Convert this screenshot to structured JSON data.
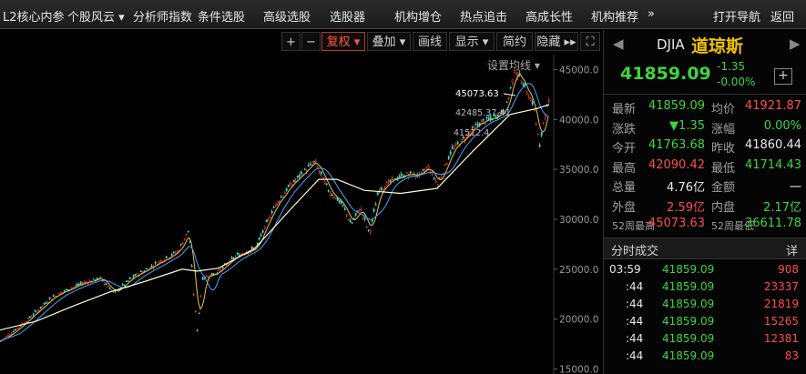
{
  "nav": {
    "items": [
      "L2核心内参",
      "个股风云 ▾",
      "分析师指数",
      "条件选股",
      "高级选股",
      "选股器",
      "机构增仓",
      "热点追击",
      "高成长性",
      "机构推荐",
      "»",
      "打开导航",
      "返回"
    ]
  },
  "toolbar": {
    "plus": "+",
    "minus": "−",
    "fuquan": "复权 ▾",
    "diejia": "叠加 ▾",
    "huaxian": "画线",
    "xianshi": "显示 ▾",
    "jianyue": "简约",
    "yincang": "隐藏 ▸▸",
    "fullscreen": "⛶",
    "set_ma": "设置均线 ▾"
  },
  "chart_data": {
    "type": "candlestick",
    "title": "",
    "price_axis": [
      45000.0,
      40000.0,
      35000.0,
      30000.0,
      25000.0,
      20000.0,
      15000.0
    ],
    "price_axis_labels": [
      "45000.0",
      "40000.0",
      "35000.0",
      "30000.0",
      "25000.0",
      "20000.0",
      "15000.0"
    ],
    "ylim": [
      14500,
      46500
    ],
    "annotations": [
      "45073.63",
      "42485.37-41",
      "41512.4"
    ],
    "close_path": [
      [
        0,
        17800
      ],
      [
        20,
        19200
      ],
      [
        40,
        20800
      ],
      [
        55,
        22100
      ],
      [
        70,
        22800
      ],
      [
        90,
        23600
      ],
      [
        110,
        24100
      ],
      [
        125,
        22600
      ],
      [
        145,
        24200
      ],
      [
        170,
        25500
      ],
      [
        195,
        26800
      ],
      [
        207,
        29000
      ],
      [
        212,
        22500
      ],
      [
        216,
        18900
      ],
      [
        222,
        24100
      ],
      [
        240,
        24800
      ],
      [
        260,
        26400
      ],
      [
        280,
        27100
      ],
      [
        300,
        31200
      ],
      [
        315,
        33100
      ],
      [
        330,
        34500
      ],
      [
        345,
        35800
      ],
      [
        360,
        32900
      ],
      [
        375,
        31500
      ],
      [
        385,
        29500
      ],
      [
        395,
        31200
      ],
      [
        405,
        28500
      ],
      [
        415,
        32900
      ],
      [
        430,
        33900
      ],
      [
        445,
        34500
      ],
      [
        460,
        34400
      ],
      [
        470,
        35200
      ],
      [
        480,
        33500
      ],
      [
        495,
        36900
      ],
      [
        510,
        38200
      ],
      [
        525,
        39600
      ],
      [
        540,
        40100
      ],
      [
        555,
        41100
      ],
      [
        565,
        45073
      ],
      [
        575,
        43400
      ],
      [
        585,
        41500
      ],
      [
        592,
        37200
      ],
      [
        597,
        40400
      ],
      [
        603,
        41859
      ]
    ],
    "ma_slow_path": [
      [
        0,
        18900
      ],
      [
        40,
        19800
      ],
      [
        80,
        21300
      ],
      [
        120,
        22700
      ],
      [
        160,
        23800
      ],
      [
        200,
        25000
      ],
      [
        216,
        24800
      ],
      [
        240,
        25100
      ],
      [
        280,
        27100
      ],
      [
        320,
        31100
      ],
      [
        350,
        34000
      ],
      [
        370,
        34000
      ],
      [
        400,
        32900
      ],
      [
        440,
        32600
      ],
      [
        480,
        33100
      ],
      [
        520,
        36900
      ],
      [
        560,
        40500
      ],
      [
        590,
        41100
      ],
      [
        603,
        41500
      ]
    ]
  },
  "quote": {
    "code": "DJIA",
    "name": "道琼斯",
    "price": "41859.09",
    "change": "-1.35",
    "pct": "-0.00%"
  },
  "stats": [
    {
      "l1": "最新",
      "v1": "41859.09",
      "c1": "green",
      "l2": "均价",
      "v2": "41921.87",
      "c2": "red"
    },
    {
      "l1": "涨跌",
      "v1": "▼1.35",
      "c1": "green",
      "l2": "涨幅",
      "v2": "0.00%",
      "c2": "green"
    },
    {
      "l1": "今开",
      "v1": "41763.68",
      "c1": "green",
      "l2": "昨收",
      "v2": "41860.44",
      "c2": "white"
    },
    {
      "l1": "最高",
      "v1": "42090.42",
      "c1": "red",
      "l2": "最低",
      "v2": "41714.43",
      "c2": "green"
    },
    {
      "l1": "总量",
      "v1": "4.76亿",
      "c1": "white",
      "l2": "金额",
      "v2": "一",
      "c2": "white"
    },
    {
      "l1": "外盘",
      "v1": "2.59亿",
      "c1": "red",
      "l2": "内盘",
      "v2": "2.17亿",
      "c2": "green"
    },
    {
      "l1": "52周最高",
      "v1": "45073.63",
      "c1": "red",
      "l2": "52周最低",
      "v2": "36611.78",
      "c2": "green"
    }
  ],
  "trades_title": "分时成交",
  "trades_more": "详",
  "trades": [
    {
      "time": "03:59",
      "price": "41859.09",
      "vol": "908",
      "vc": "red"
    },
    {
      "time": ":44",
      "price": "41859.09",
      "vol": "23337",
      "vc": "red"
    },
    {
      "time": ":44",
      "price": "41859.09",
      "vol": "21819",
      "vc": "red"
    },
    {
      "time": ":44",
      "price": "41859.09",
      "vol": "15265",
      "vc": "red"
    },
    {
      "time": ":44",
      "price": "41859.09",
      "vol": "12381",
      "vc": "red"
    },
    {
      "time": ":44",
      "price": "41859.09",
      "vol": "83",
      "vc": "red"
    }
  ]
}
